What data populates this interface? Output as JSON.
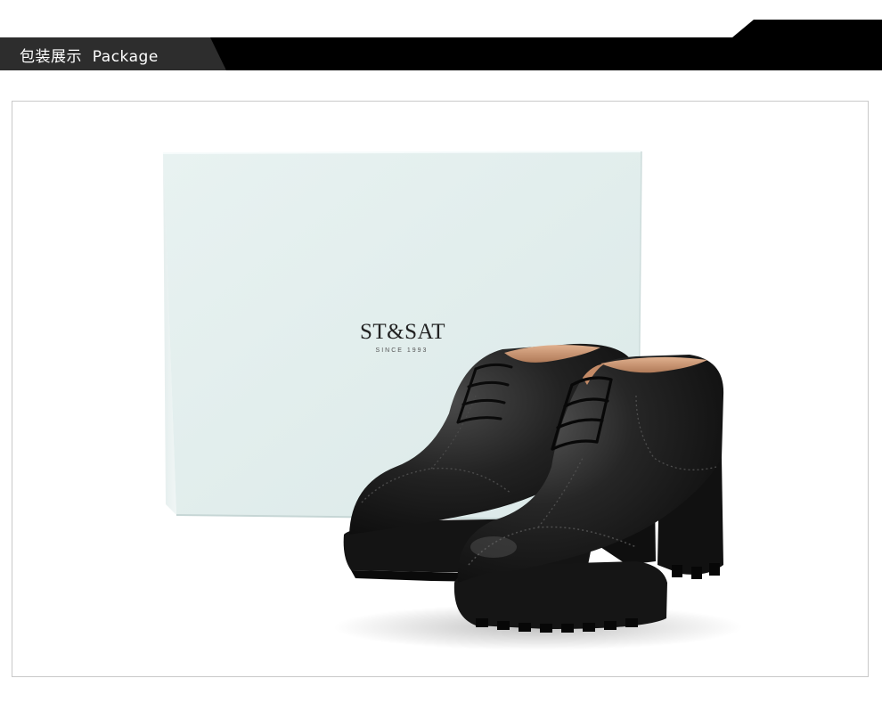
{
  "section_header": {
    "title": "包装展示  Package"
  },
  "product_photo": {
    "box_brand": "ST&SAT",
    "box_tagline": "SINCE 1993"
  },
  "colors": {
    "header_bar": "#000000",
    "header_tab": "#2d2d2d",
    "header_text": "#ffffff",
    "frame_border": "#c9c9c9",
    "box_color": "#e3f0ef",
    "shoe_color": "#1a1a1a"
  }
}
